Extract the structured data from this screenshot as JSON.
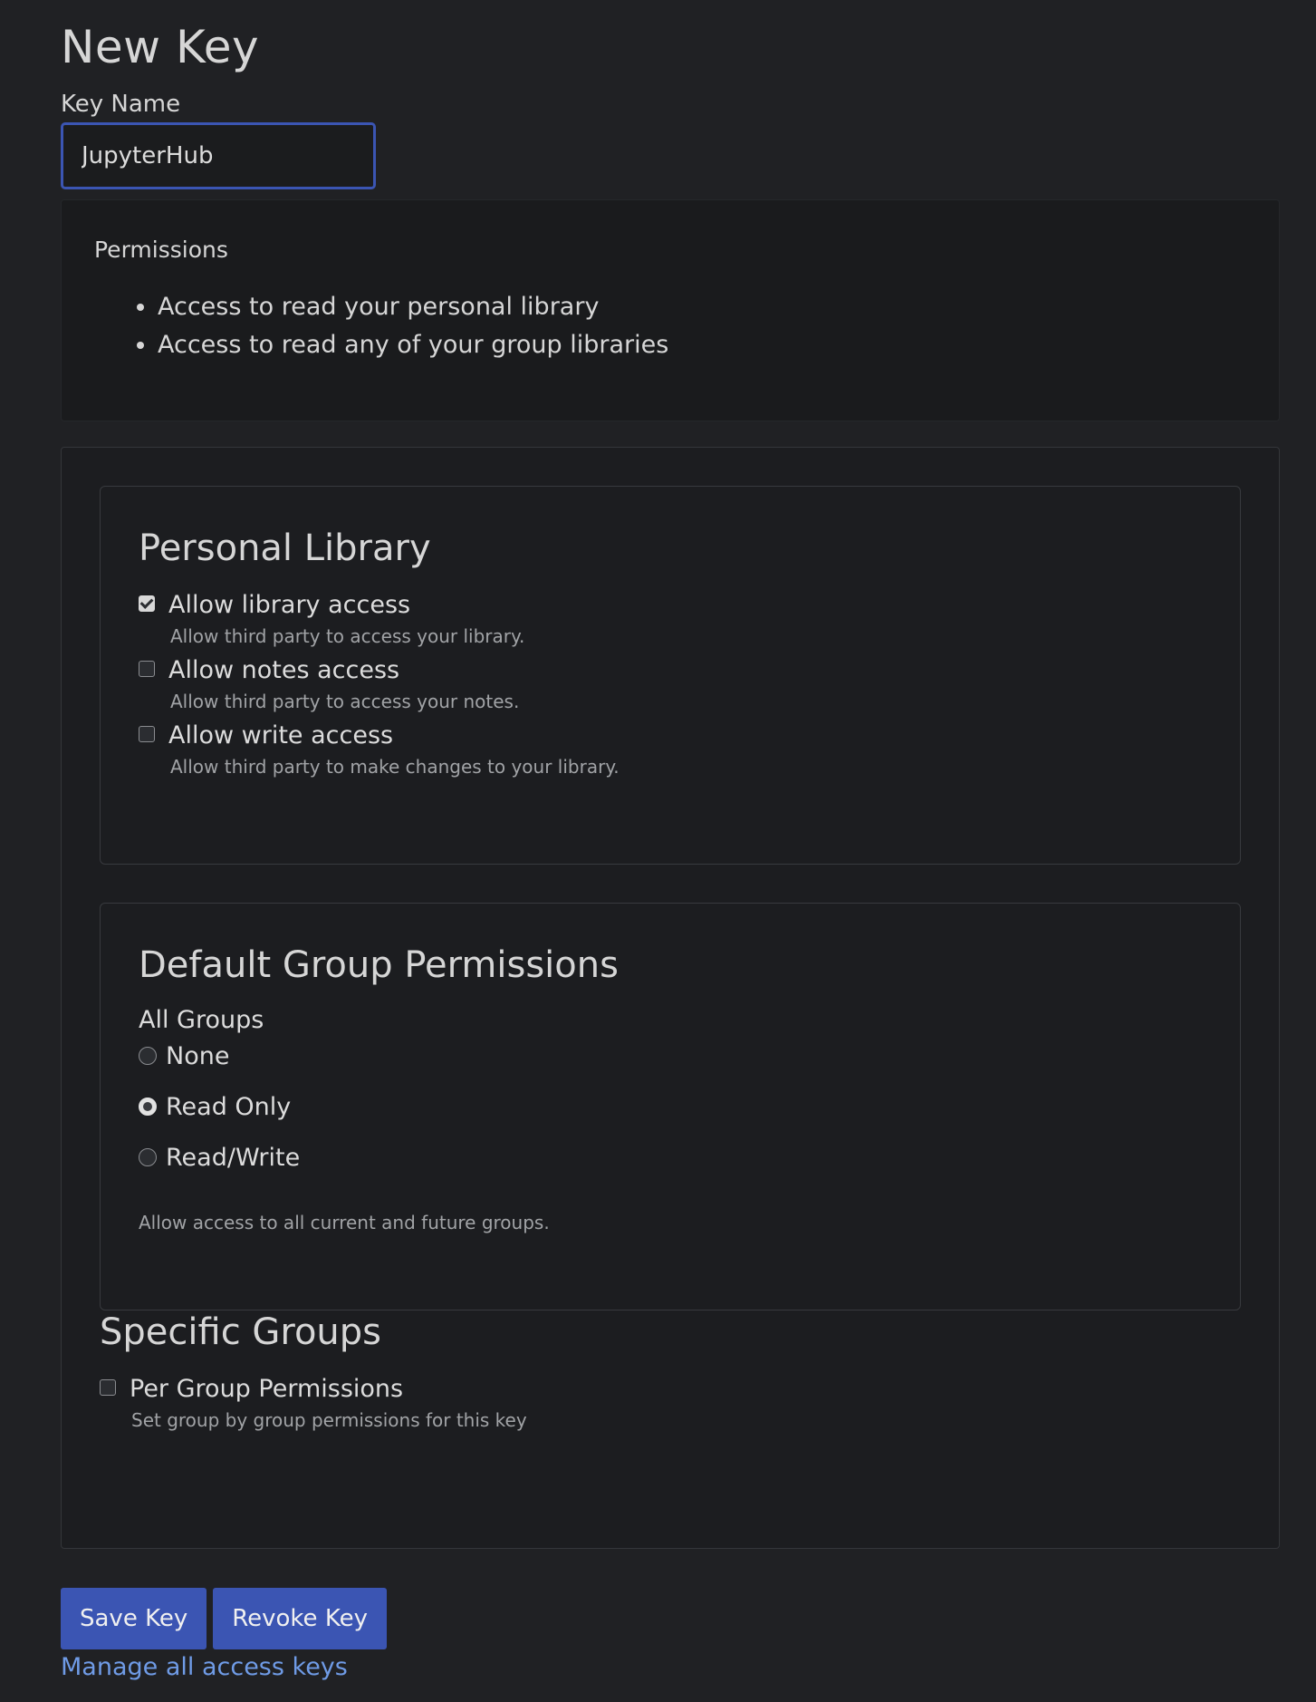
{
  "page": {
    "title": "New Key"
  },
  "key_name": {
    "label": "Key Name",
    "value": "JupyterHub"
  },
  "permissions": {
    "title": "Permissions",
    "items": [
      "Access to read your personal library",
      "Access to read any of your group libraries"
    ]
  },
  "personal_library": {
    "title": "Personal Library",
    "options": [
      {
        "label": "Allow library access",
        "help": "Allow third party to access your library.",
        "checked": true
      },
      {
        "label": "Allow notes access",
        "help": "Allow third party to access your notes.",
        "checked": false
      },
      {
        "label": "Allow write access",
        "help": "Allow third party to make changes to your library.",
        "checked": false
      }
    ]
  },
  "default_group": {
    "title": "Default Group Permissions",
    "group_label": "All Groups",
    "options": [
      {
        "label": "None",
        "selected": false
      },
      {
        "label": "Read Only",
        "selected": true
      },
      {
        "label": "Read/Write",
        "selected": false
      }
    ],
    "help": "Allow access to all current and future groups."
  },
  "specific_groups": {
    "title": "Specific Groups",
    "option_label": "Per Group Permissions",
    "option_help": "Set group by group permissions for this key",
    "checked": false
  },
  "actions": {
    "save_label": "Save Key",
    "revoke_label": "Revoke Key",
    "manage_link": "Manage all access keys"
  },
  "colors": {
    "background": "#202124",
    "accent": "#3b55b3",
    "link": "#6f9be6"
  }
}
